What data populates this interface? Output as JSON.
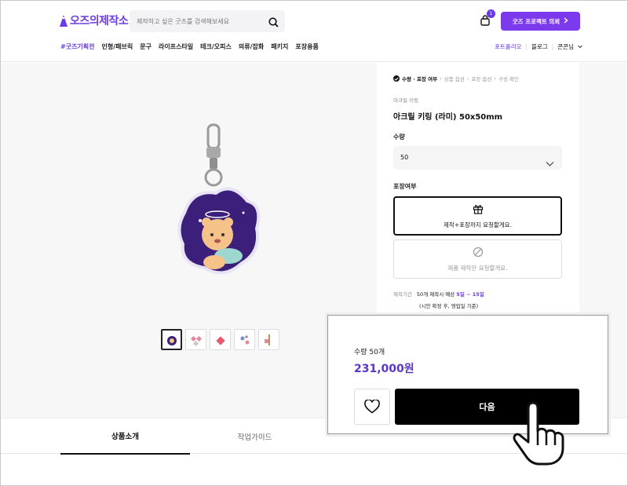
{
  "header": {
    "logo": "오즈의제작소",
    "search_placeholder": "제작하고 싶은 굿즈를 검색해보세요",
    "cart_count": "1",
    "cta_label": "굿즈 프로젝트 의뢰"
  },
  "nav": {
    "items": [
      "#굿즈기획전",
      "인형/패브릭",
      "문구",
      "라이프스타일",
      "테크/오피스",
      "의류/잡화",
      "패키지",
      "포장용품"
    ],
    "right": [
      "포트폴리오",
      "블로그",
      "콘콘님"
    ]
  },
  "steps": [
    "수량 · 포장 여부",
    "상품 옵션",
    "포장 옵션",
    "구성 확인"
  ],
  "product": {
    "category": "아크릴 키링",
    "name": "아크릴 키링 (라미) 50x50mm",
    "quantity_label": "수량",
    "quantity_value": "50",
    "packaging_label": "포장여부",
    "option_1": "제작+포장까지 요청할게요.",
    "option_2": "제품 제작만 요청할게요.",
    "period_label": "제작기간",
    "period_text": "50개 제작시 예상",
    "period_range": "5일 ~ 15일",
    "period_note": "(시안 확정 후, 영업일 기준)"
  },
  "tabs": [
    "상품소개",
    "작업가이드"
  ],
  "popup": {
    "quantity": "수량 50개",
    "price": "231,000원",
    "next_label": "다음"
  },
  "colors": {
    "accent": "#7c3aed",
    "price": "#5b35c4"
  }
}
